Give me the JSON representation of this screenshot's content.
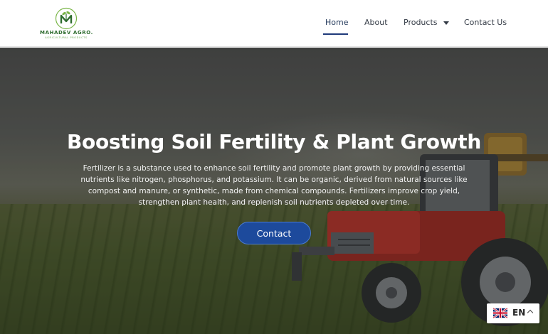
{
  "logo": {
    "brand": "MAHADEV AGRO.",
    "tagline": "AGRICULTURAL PRODUCTS",
    "icon": "leaf-monogram-icon"
  },
  "nav": {
    "items": [
      {
        "label": "Home",
        "active": true
      },
      {
        "label": "About"
      },
      {
        "label": "Products",
        "icon": "caret-down-icon"
      },
      {
        "label": "Contact Us"
      }
    ]
  },
  "hero": {
    "title": "Boosting Soil Fertility & Plant Growth",
    "text": "Fertilizer is a substance used to enhance soil fertility and promote plant growth by providing essential nutrients like nitrogen, phosphorus, and potassium. It can be organic, derived from natural sources like compost and manure, or synthetic, made from chemical compounds. Fertilizers improve crop yield, strengthen plant health, and replenish soil nutrients depleted over time.",
    "button": "Contact"
  },
  "language": {
    "code": "EN",
    "flag": "uk-flag-icon",
    "chevron": "chevron-up-icon"
  },
  "colors": {
    "nav_active": "#1f3a7a",
    "button": "#1d4a9c",
    "brand_green": "#2f6d2f"
  }
}
